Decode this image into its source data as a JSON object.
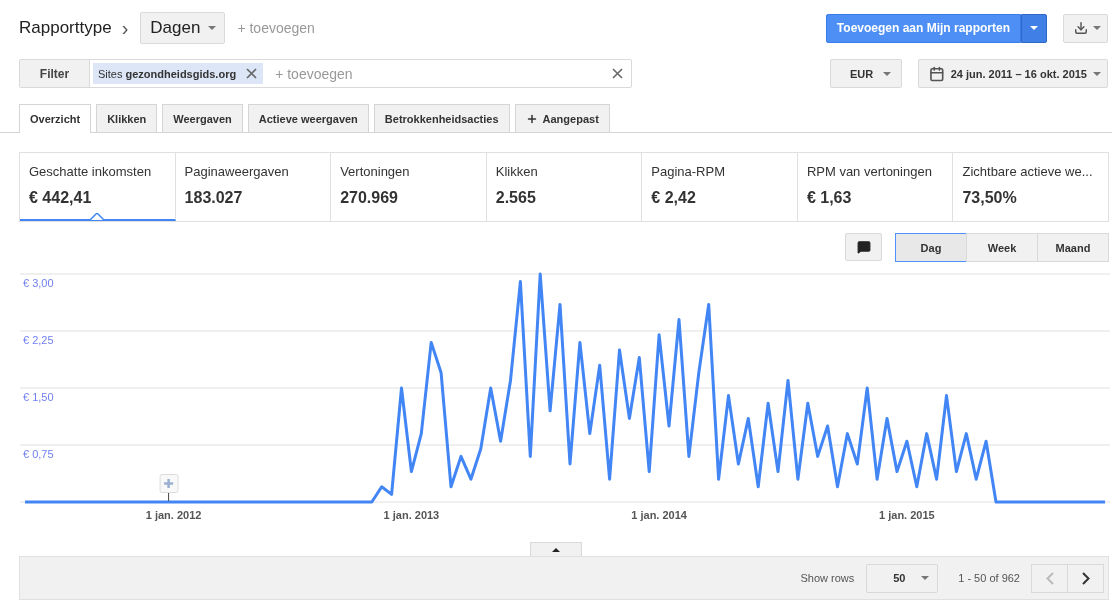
{
  "header": {
    "title": "Rapporttype",
    "separator": "›",
    "dimension": "Dagen",
    "add_link": "+ toevoegen",
    "save_button": "Toevoegen aan Mijn rapporten"
  },
  "filter": {
    "label": "Filter",
    "chips": [
      {
        "text": "Sites **gezondheidsgids.org**"
      }
    ],
    "placeholder": "+ toevoegen"
  },
  "currency": "EUR",
  "date_range": "24 jun. 2011 – 16 okt. 2015",
  "tabs": [
    {
      "label": "Overzicht",
      "selected": true,
      "kind": "plain"
    },
    {
      "label": "Klikken",
      "selected": false,
      "kind": "plain"
    },
    {
      "label": "Weergaven",
      "selected": false,
      "kind": "plain"
    },
    {
      "label": "Actieve weergaven",
      "selected": false,
      "kind": "plain"
    },
    {
      "label": "Betrokkenheidsacties",
      "selected": false,
      "kind": "plain"
    },
    {
      "label": "Aangepast",
      "selected": false,
      "kind": "add"
    }
  ],
  "metrics": [
    {
      "label": "Geschatte inkomsten",
      "value": "€ 442,41",
      "selected": true
    },
    {
      "label": "Paginaweergaven",
      "value": "183.027",
      "selected": false
    },
    {
      "label": "Vertoningen",
      "value": "270.969",
      "selected": false
    },
    {
      "label": "Klikken",
      "value": "2.565",
      "selected": false
    },
    {
      "label": "Pagina-RPM",
      "value": "€ 2,42",
      "selected": false
    },
    {
      "label": "RPM van vertoningen",
      "value": "€ 1,63",
      "selected": false
    },
    {
      "label": "Zichtbare actieve we...",
      "value": "73,50%",
      "selected": false
    }
  ],
  "granularity": [
    {
      "label": "Dag",
      "selected": true
    },
    {
      "label": "Week",
      "selected": false
    },
    {
      "label": "Maand",
      "selected": false
    }
  ],
  "chart_data": {
    "type": "line",
    "grid": true,
    "ylim": [
      0,
      3
    ],
    "categories": [
      null,
      null,
      null,
      null,
      null,
      null,
      null,
      null,
      null,
      null,
      null,
      null,
      null,
      null,
      null,
      "1 jan. 2012",
      null,
      null,
      null,
      null,
      null,
      null,
      null,
      null,
      null,
      null,
      null,
      null,
      null,
      null,
      null,
      null,
      null,
      null,
      null,
      null,
      null,
      null,
      null,
      "1 jan. 2013",
      null,
      null,
      null,
      null,
      null,
      null,
      null,
      null,
      null,
      null,
      null,
      null,
      null,
      null,
      null,
      null,
      null,
      null,
      null,
      null,
      null,
      null,
      null,
      null,
      "1 jan. 2014",
      null,
      null,
      null,
      null,
      null,
      null,
      null,
      null,
      null,
      null,
      null,
      null,
      null,
      null,
      null,
      null,
      null,
      null,
      null,
      null,
      null,
      null,
      null,
      null,
      "1 jan. 2015",
      null,
      null,
      null,
      null,
      null,
      null,
      null,
      null,
      null,
      null,
      null,
      null,
      null,
      null,
      null,
      null,
      null,
      null,
      null,
      null
    ],
    "yticks": [
      {
        "value": 0.75,
        "label": "€ 0,75"
      },
      {
        "value": 1.5,
        "label": "€ 1,50"
      },
      {
        "value": 2.25,
        "label": "€ 2,25"
      },
      {
        "value": 3,
        "label": "€ 3,00"
      }
    ],
    "series": [
      {
        "color": "#4285f4",
        "values": [
          0,
          0,
          0,
          0,
          0,
          0,
          0,
          0,
          0,
          0,
          0,
          0,
          0,
          0,
          0,
          0,
          0,
          0,
          0,
          0,
          0,
          0,
          0,
          0,
          0,
          0,
          0,
          0,
          0,
          0,
          0,
          0,
          0,
          0,
          0,
          0,
          0.2,
          0.1,
          1.5,
          0.4,
          0.9,
          2.1,
          1.7,
          0.2,
          0.6,
          0.3,
          0.7,
          1.5,
          0.8,
          1.6,
          2.9,
          0.6,
          3.0,
          1.2,
          2.6,
          0.5,
          2.1,
          0.9,
          1.8,
          0.3,
          2.0,
          1.1,
          1.9,
          0.4,
          2.2,
          1.0,
          2.4,
          0.6,
          1.7,
          2.6,
          0.3,
          1.4,
          0.5,
          1.1,
          0.2,
          1.3,
          0.4,
          1.6,
          0.3,
          1.3,
          0.6,
          1.0,
          0.2,
          0.9,
          0.5,
          1.5,
          0.3,
          1.1,
          0.4,
          0.8,
          0.2,
          0.9,
          0.3,
          1.4,
          0.4,
          0.9,
          0.3,
          0.8,
          0,
          0,
          0,
          0,
          0,
          0,
          0,
          0,
          0,
          0,
          0,
          0
        ]
      }
    ]
  },
  "pagination": {
    "show_rows_label": "Show rows",
    "rows": "50",
    "range": "1 - 50 of 962",
    "pager": [
      {
        "kind": "prev",
        "disabled": true
      },
      {
        "kind": "next",
        "disabled": false
      }
    ]
  }
}
